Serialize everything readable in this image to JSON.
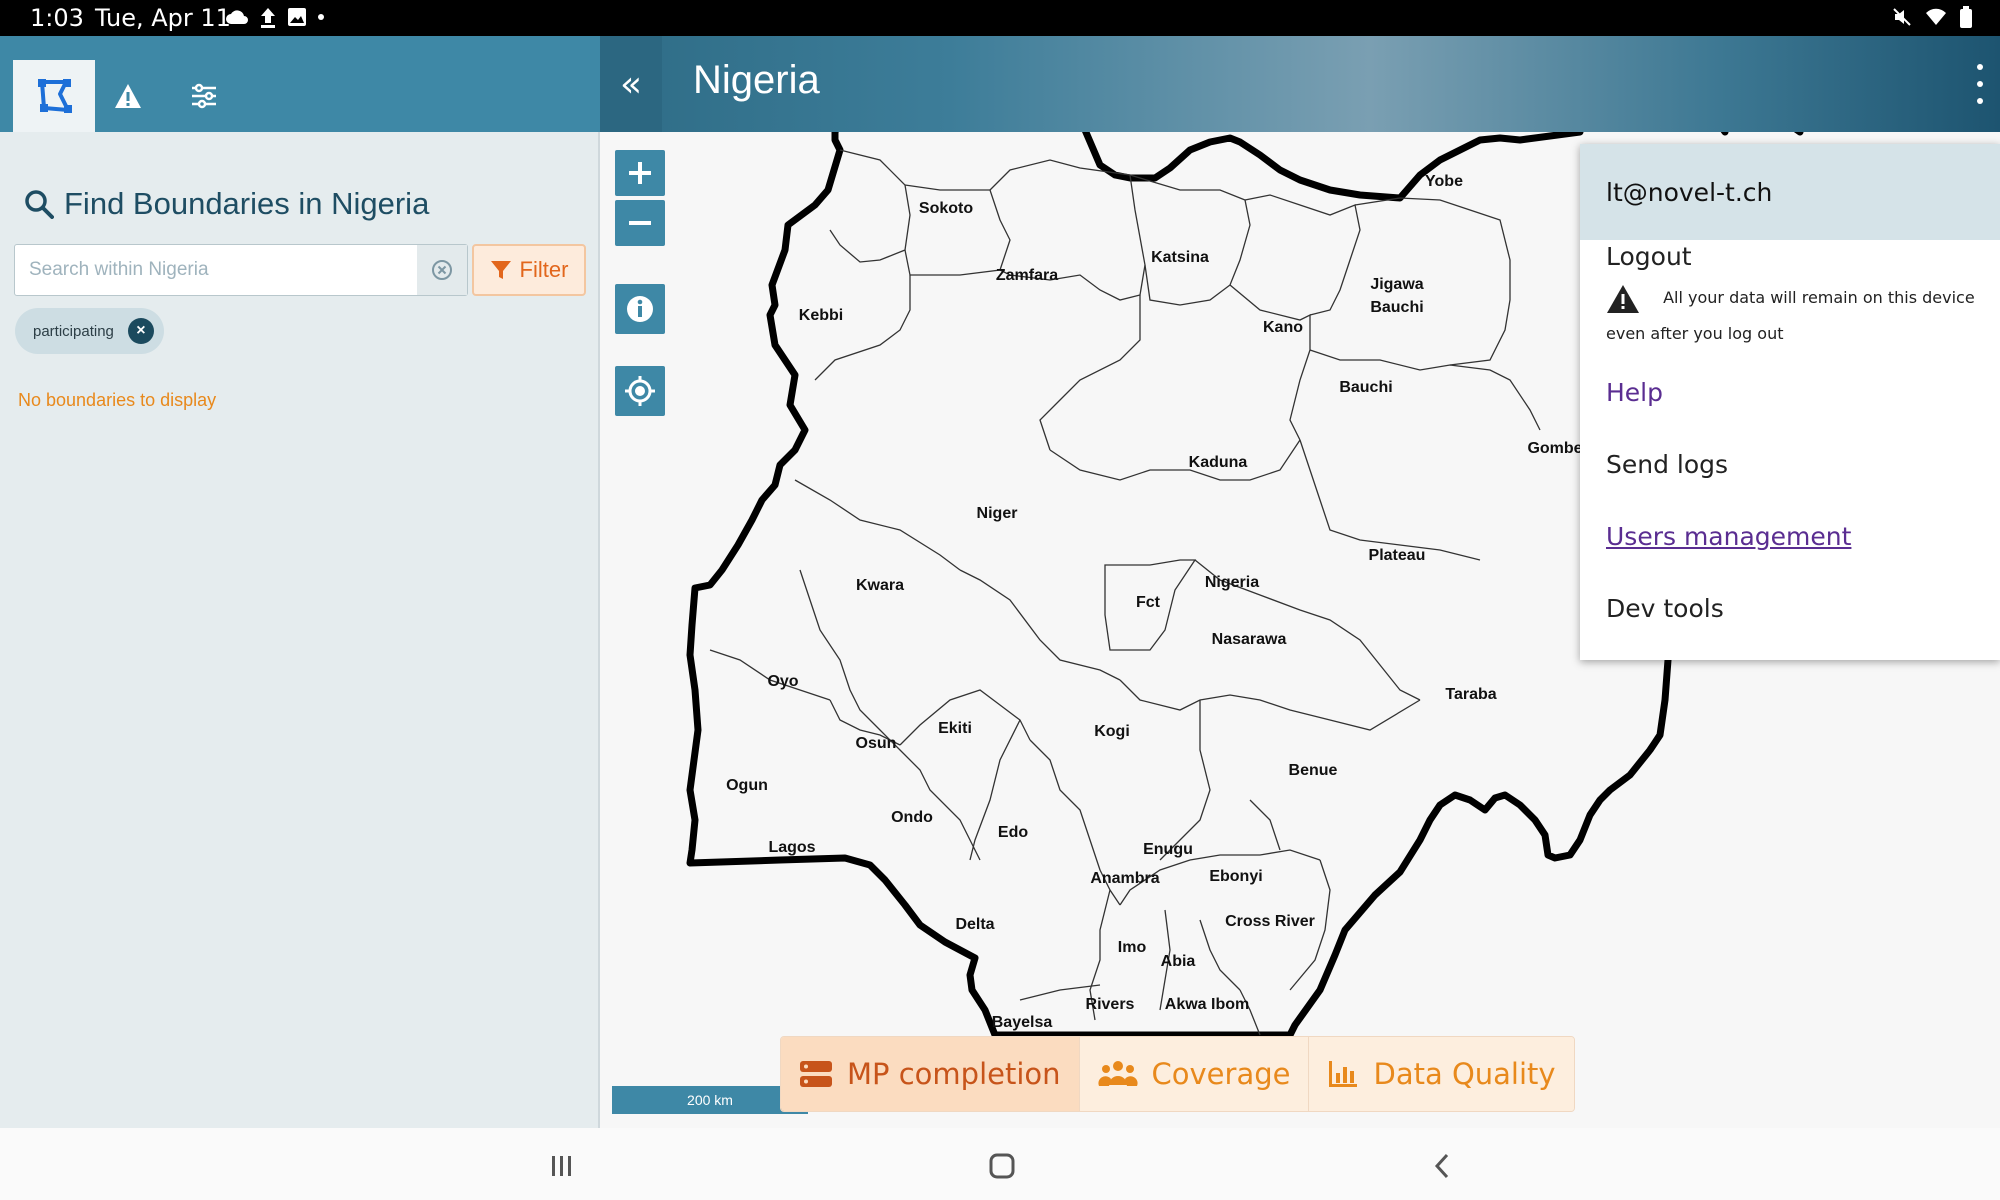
{
  "status_bar": {
    "time": "1:03",
    "date": "Tue, Apr 11",
    "left_icons": [
      "cloud-icon",
      "upload-icon",
      "image-icon",
      "dot-icon"
    ],
    "right_icons": [
      "mute-icon",
      "wifi-icon",
      "battery-icon"
    ]
  },
  "left_panel": {
    "tabs": [
      {
        "name": "boundaries",
        "icon": "boundary-icon",
        "active": true
      },
      {
        "name": "alerts",
        "icon": "warning-icon",
        "active": false
      },
      {
        "name": "settings",
        "icon": "sliders-icon",
        "active": false
      }
    ],
    "title": "Find Boundaries in Nigeria",
    "search": {
      "placeholder": "Search within Nigeria",
      "value": ""
    },
    "filter_label": "Filter",
    "chip_label": "participating",
    "empty_message": "No boundaries to display"
  },
  "header": {
    "collapse_icon": "«",
    "title": "Nigeria"
  },
  "map": {
    "states": [
      "Sokoto",
      "Zamfara",
      "Katsina",
      "Kebbi",
      "Yobe",
      "Jigawa",
      "Bauchi",
      "Kano",
      "Bauchi",
      "Kaduna",
      "Niger",
      "Plateau",
      "Gombe",
      "Kwara",
      "Fct",
      "Nigeria",
      "Nasarawa",
      "Oyo",
      "Taraba",
      "Ekiti",
      "Osun",
      "Kogi",
      "Ogun",
      "Benue",
      "Ondo",
      "Edo",
      "Lagos",
      "Enugu",
      "Anambra",
      "Ebonyi",
      "Delta",
      "Cross River",
      "Imo",
      "Abia",
      "Rivers",
      "Akwa Ibom",
      "Bayelsa"
    ],
    "scale_label": "200 km"
  },
  "bottom_tabs": [
    {
      "label": "MP completion",
      "icon": "server-icon",
      "active": true
    },
    {
      "label": "Coverage",
      "icon": "users-icon",
      "active": false
    },
    {
      "label": "Data Quality",
      "icon": "bar-chart-icon",
      "active": false
    }
  ],
  "menu": {
    "user": "lt@novel-t.ch",
    "logout": "Logout",
    "warning_line1": "All your data will remain on this device",
    "warning_line2": "even after you log out",
    "help": "Help",
    "send_logs": "Send logs",
    "users_management": "Users management",
    "dev_tools": "Dev tools"
  },
  "colors": {
    "primary": "#3e88a6",
    "accent_orange": "#e8891c",
    "link_purple": "#5a2d91"
  }
}
